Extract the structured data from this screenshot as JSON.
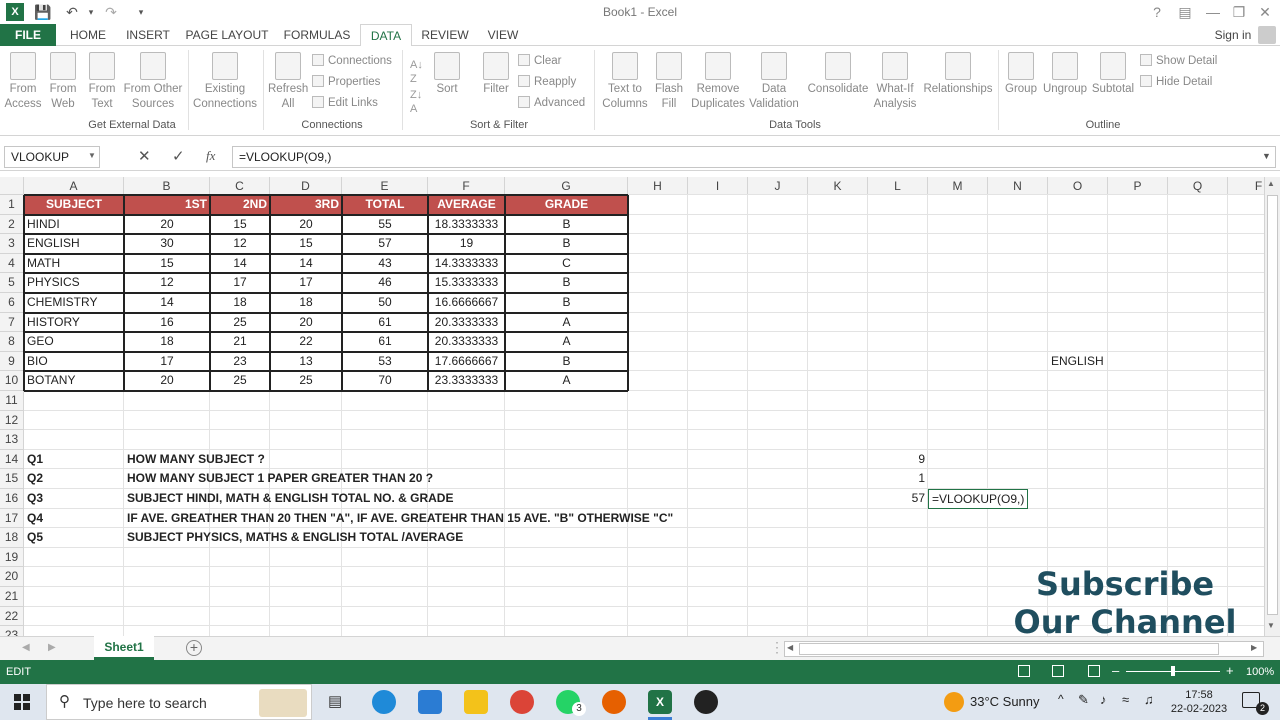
{
  "window": {
    "title": "Book1 - Excel",
    "help": "?",
    "sign_in": "Sign in"
  },
  "tabs": [
    {
      "label": "FILE"
    },
    {
      "label": "HOME"
    },
    {
      "label": "INSERT"
    },
    {
      "label": "PAGE LAYOUT"
    },
    {
      "label": "FORMULAS"
    },
    {
      "label": "DATA"
    },
    {
      "label": "REVIEW"
    },
    {
      "label": "VIEW"
    }
  ],
  "ribbon": {
    "get_external": {
      "from_access": "From Access",
      "from_web": "From Web",
      "from_text": "From Text",
      "from_other": "From Other Sources",
      "existing": "Existing Connections",
      "group": "Get External Data"
    },
    "connections": {
      "refresh": "Refresh All",
      "connections": "Connections",
      "properties": "Properties",
      "edit_links": "Edit Links",
      "group": "Connections"
    },
    "sort_filter": {
      "sort": "Sort",
      "filter": "Filter",
      "clear": "Clear",
      "reapply": "Reapply",
      "advanced": "Advanced",
      "group": "Sort & Filter"
    },
    "data_tools": {
      "text_to_columns": "Text to Columns",
      "flash_fill": "Flash Fill",
      "remove_duplicates": "Remove Duplicates",
      "data_validation": "Data Validation",
      "consolidate": "Consolidate",
      "what_if": "What-If Analysis",
      "relationships": "Relationships",
      "group": "Data Tools"
    },
    "outline": {
      "group_btn": "Group",
      "ungroup": "Ungroup",
      "subtotal": "Subtotal",
      "show_detail": "Show Detail",
      "hide_detail": "Hide Detail",
      "group": "Outline"
    }
  },
  "formula_bar": {
    "name_box": "VLOOKUP",
    "fx": "fx",
    "formula": "=VLOOKUP(O9,)"
  },
  "columns": [
    "A",
    "B",
    "C",
    "D",
    "E",
    "F",
    "G",
    "H",
    "I",
    "J",
    "K",
    "L",
    "M",
    "N",
    "O",
    "P",
    "Q",
    "F"
  ],
  "rows": [
    "1",
    "2",
    "3",
    "4",
    "5",
    "6",
    "7",
    "8",
    "9",
    "10",
    "11",
    "12",
    "13",
    "14",
    "15",
    "16",
    "17",
    "18",
    "19",
    "20",
    "21",
    "22",
    "23"
  ],
  "table": {
    "headers": [
      "SUBJECT",
      "1ST",
      "2ND",
      "3RD",
      "TOTAL",
      "AVERAGE",
      "GRADE"
    ],
    "rows": [
      [
        "HINDI",
        "20",
        "15",
        "20",
        "55",
        "18.3333333",
        "B"
      ],
      [
        "ENGLISH",
        "30",
        "12",
        "15",
        "57",
        "19",
        "B"
      ],
      [
        "MATH",
        "15",
        "14",
        "14",
        "43",
        "14.3333333",
        "C"
      ],
      [
        "PHYSICS",
        "12",
        "17",
        "17",
        "46",
        "15.3333333",
        "B"
      ],
      [
        "CHEMISTRY",
        "14",
        "18",
        "18",
        "50",
        "16.6666667",
        "B"
      ],
      [
        "HISTORY",
        "16",
        "25",
        "20",
        "61",
        "20.3333333",
        "A"
      ],
      [
        "GEO",
        "18",
        "21",
        "22",
        "61",
        "20.3333333",
        "A"
      ],
      [
        "BIO",
        "17",
        "23",
        "13",
        "53",
        "17.6666667",
        "B"
      ],
      [
        "BOTANY",
        "20",
        "25",
        "25",
        "70",
        "23.3333333",
        "A"
      ]
    ]
  },
  "o9": "ENGLISH",
  "questions": [
    {
      "id": "Q1",
      "text": "HOW MANY SUBJECT ?",
      "answer": "9"
    },
    {
      "id": "Q2",
      "text": "HOW MANY SUBJECT 1 PAPER GREATER THAN 20 ?",
      "answer": "1"
    },
    {
      "id": "Q3",
      "text": "SUBJECT HINDI, MATH & ENGLISH TOTAL NO. & GRADE",
      "answer": "57"
    },
    {
      "id": "Q4",
      "text": "IF AVE. GREATHER THAN 20 THEN \"A\", IF AVE. GREATEHR THAN 15 AVE. \"B\" OTHERWISE \"C\"",
      "answer": ""
    },
    {
      "id": "Q5",
      "text": "SUBJECT PHYSICS, MATHS & ENGLISH TOTAL /AVERAGE",
      "answer": ""
    }
  ],
  "m16": "=VLOOKUP(O9,)",
  "overlay": {
    "line1": "Subscribe",
    "line2": "Our Channel"
  },
  "sheet_tab": "Sheet1",
  "status": {
    "mode": "EDIT",
    "zoom": "100%"
  },
  "taskbar": {
    "search": "Type here to search",
    "weather": "33°C  Sunny",
    "time": "17:58",
    "date": "22-02-2023",
    "whatsapp_badge": "3",
    "notif": "2"
  },
  "colors": {
    "excel_green": "#217346",
    "header_red": "#c0504d"
  }
}
